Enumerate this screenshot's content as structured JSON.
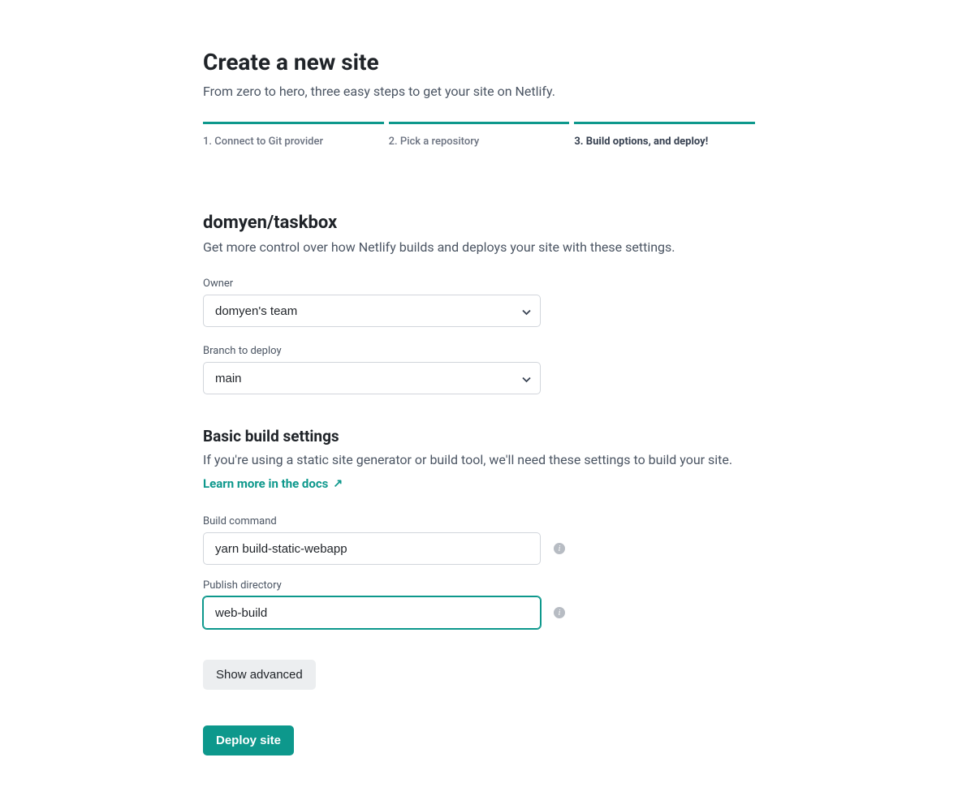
{
  "header": {
    "title": "Create a new site",
    "subtitle": "From zero to hero, three easy steps to get your site on Netlify."
  },
  "steps": [
    {
      "label": "1. Connect to Git provider",
      "active": false
    },
    {
      "label": "2. Pick a repository",
      "active": false
    },
    {
      "label": "3. Build options, and deploy!",
      "active": true
    }
  ],
  "repo": {
    "name": "domyen/taskbox",
    "description": "Get more control over how Netlify builds and deploys your site with these settings."
  },
  "owner": {
    "label": "Owner",
    "value": "domyen's team"
  },
  "branch": {
    "label": "Branch to deploy",
    "value": "main"
  },
  "build_settings": {
    "title": "Basic build settings",
    "description": "If you're using a static site generator or build tool, we'll need these settings to build your site.",
    "docs_link": "Learn more in the docs"
  },
  "build_command": {
    "label": "Build command",
    "value": "yarn build-static-webapp"
  },
  "publish_directory": {
    "label": "Publish directory",
    "value": "web-build"
  },
  "buttons": {
    "show_advanced": "Show advanced",
    "deploy": "Deploy site"
  }
}
